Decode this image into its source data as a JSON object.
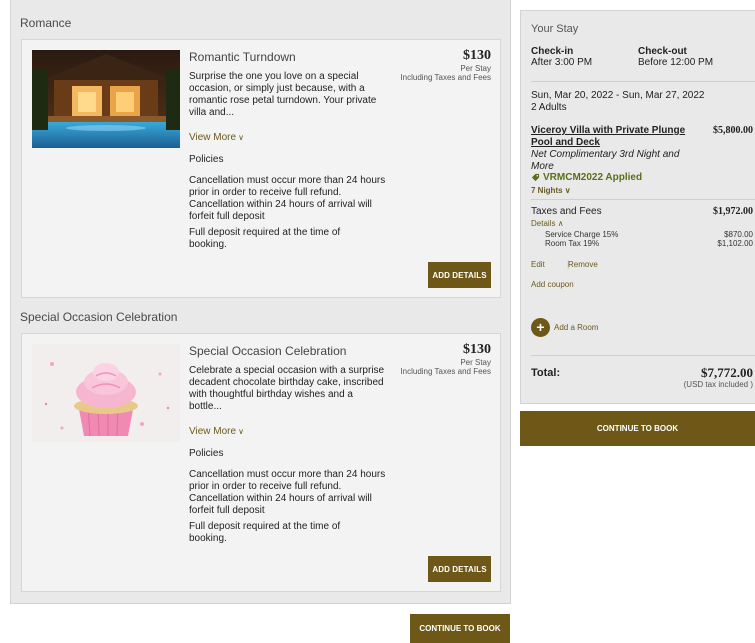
{
  "packages": [
    {
      "section_heading": "Romance",
      "title": "Romantic Turndown",
      "price": "$130",
      "price_unit": "Per Stay",
      "price_tax_note": "Including Taxes and Fees",
      "description": "Surprise the one you love on a special occasion, or simply just because, with a romantic rose petal turndown. Your private villa and...",
      "view_more": "View More",
      "policies_label": "Policies",
      "cancellation_policy": "Cancellation must occur more than 24 hours prior in order to receive full refund. Cancellation within 24 hours of arrival will forfeit full deposit",
      "deposit_policy": "Full deposit required at the time of booking.",
      "add_details_label": "ADD DETAILS"
    },
    {
      "section_heading": "Special Occasion Celebration",
      "title": "Special Occasion Celebration",
      "price": "$130",
      "price_unit": "Per Stay",
      "price_tax_note": "Including Taxes and Fees",
      "description": "Celebrate a special occasion with a surprise decadent chocolate birthday cake, inscribed with thoughtful birthday wishes and a bottle...",
      "view_more": "View More",
      "policies_label": "Policies",
      "cancellation_policy": "Cancellation must occur more than 24 hours prior in order to receive full refund. Cancellation within 24 hours of arrival will forfeit full deposit",
      "deposit_policy": "Full deposit required at the time of booking.",
      "add_details_label": "ADD DETAILS"
    }
  ],
  "continue_label": "CONTINUE TO BOOK",
  "stay": {
    "title": "Your Stay",
    "checkin_label": "Check-in",
    "checkin_value": "After 3:00 PM",
    "checkout_label": "Check-out",
    "checkout_value": "Before 12:00 PM",
    "dates": "Sun, Mar 20, 2022 - Sun, Mar 27, 2022",
    "guests": "2 Adults",
    "room_name": "Viceroy Villa with Private Plunge Pool and Deck",
    "room_price": "$5,800.00",
    "offer_name": "Net Complimentary 3rd Night and More",
    "promo_applied": "VRMCM2022 Applied",
    "nights": "7 Nights",
    "taxes_label": "Taxes and Fees",
    "taxes_value": "$1,972.00",
    "details_label": "Details",
    "fees": [
      {
        "name": "Service Charge 15%",
        "amount": "$870.00"
      },
      {
        "name": "Room Tax 19%",
        "amount": "$1,102.00"
      }
    ],
    "edit_label": "Edit",
    "remove_label": "Remove",
    "add_coupon_label": "Add coupon",
    "add_room_label": "Add a Room",
    "total_label": "Total:",
    "total_value": "$7,772.00",
    "total_note": "(USD tax included )"
  },
  "colors": {
    "accent": "#6e5817",
    "link": "#6b5a1e",
    "promo": "#5a6e1a",
    "panel": "#e9e9e9",
    "card": "#f3f3f3"
  }
}
